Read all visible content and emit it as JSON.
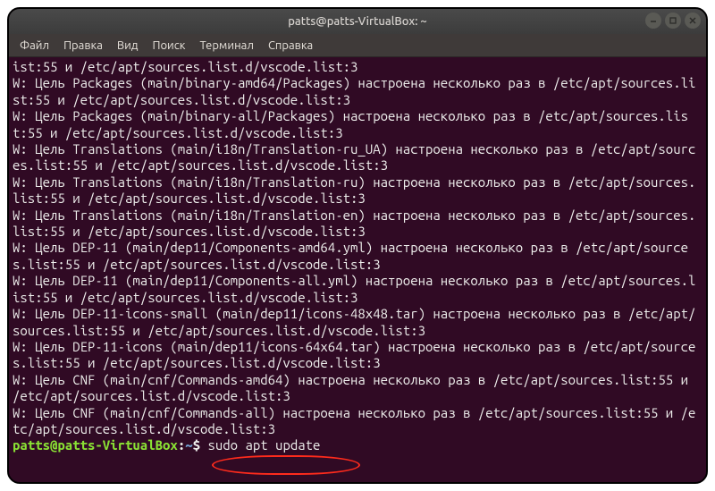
{
  "window": {
    "title": "patts@patts-VirtualBox: ~"
  },
  "menu": {
    "file": "Файл",
    "edit": "Правка",
    "view": "Вид",
    "search": "Поиск",
    "terminal": "Терминал",
    "help": "Справка"
  },
  "terminal": {
    "lines": [
      "ist:55 и /etc/apt/sources.list.d/vscode.list:3",
      "W: Цель Packages (main/binary-amd64/Packages) настроена несколько раз в /etc/apt/sources.list:55 и /etc/apt/sources.list.d/vscode.list:3",
      "W: Цель Packages (main/binary-all/Packages) настроена несколько раз в /etc/apt/sources.list:55 и /etc/apt/sources.list.d/vscode.list:3",
      "W: Цель Translations (main/i18n/Translation-ru_UA) настроена несколько раз в /etc/apt/sources.list:55 и /etc/apt/sources.list.d/vscode.list:3",
      "W: Цель Translations (main/i18n/Translation-ru) настроена несколько раз в /etc/apt/sources.list:55 и /etc/apt/sources.list.d/vscode.list:3",
      "W: Цель Translations (main/i18n/Translation-en) настроена несколько раз в /etc/apt/sources.list:55 и /etc/apt/sources.list.d/vscode.list:3",
      "W: Цель DEP-11 (main/dep11/Components-amd64.yml) настроена несколько раз в /etc/apt/sources.list:55 и /etc/apt/sources.list.d/vscode.list:3",
      "W: Цель DEP-11 (main/dep11/Components-all.yml) настроена несколько раз в /etc/apt/sources.list:55 и /etc/apt/sources.list.d/vscode.list:3",
      "W: Цель DEP-11-icons-small (main/dep11/icons-48x48.tar) настроена несколько раз в /etc/apt/sources.list:55 и /etc/apt/sources.list.d/vscode.list:3",
      "W: Цель DEP-11-icons (main/dep11/icons-64x64.tar) настроена несколько раз в /etc/apt/sources.list:55 и /etc/apt/sources.list.d/vscode.list:3",
      "W: Цель CNF (main/cnf/Commands-amd64) настроена несколько раз в /etc/apt/sources.list:55 и /etc/apt/sources.list.d/vscode.list:3",
      "W: Цель CNF (main/cnf/Commands-all) настроена несколько раз в /etc/apt/sources.list:55 и /etc/apt/sources.list.d/vscode.list:3"
    ],
    "prompt_user": "patts@patts-VirtualBox",
    "prompt_colon": ":",
    "prompt_path": "~",
    "prompt_dollar": "$",
    "command": "sudo apt update"
  },
  "icons": {
    "minimize": "minimize-icon",
    "maximize": "maximize-icon",
    "close": "close-icon"
  }
}
